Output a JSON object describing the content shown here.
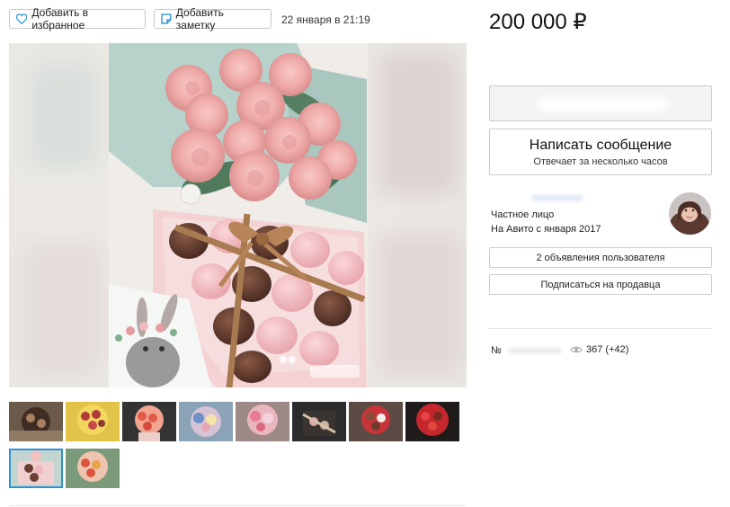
{
  "toolbar": {
    "favorite_label": "Добавить в избранное",
    "note_label": "Добавить заметку",
    "date": "22 января в 21:19"
  },
  "price": "200 000 ₽",
  "contact": {
    "message_title": "Написать сообщение",
    "message_subtitle": "Отвечает за несколько часов"
  },
  "seller": {
    "type": "Частное лицо",
    "since": "На Авито с января 2017",
    "listings_button": "2 объявления пользователя",
    "subscribe_button": "Подписаться на продавца"
  },
  "meta": {
    "number_label": "№",
    "views": "367 (+42)"
  },
  "icons": [
    "heart-icon",
    "note-icon",
    "eye-icon"
  ],
  "colors": {
    "accent": "#2c93d6",
    "border": "#c9c9c9"
  }
}
